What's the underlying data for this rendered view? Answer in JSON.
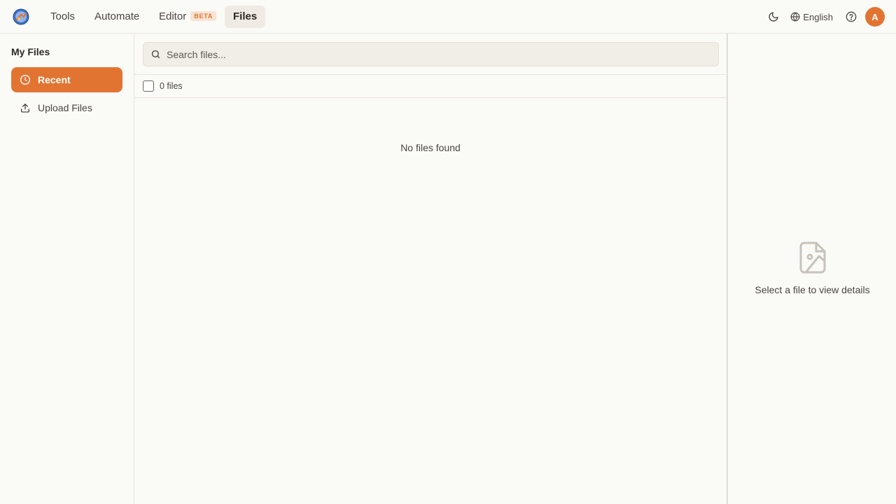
{
  "topbar": {
    "nav": [
      {
        "label": "Tools"
      },
      {
        "label": "Automate"
      },
      {
        "label": "Editor",
        "badge": "BETA"
      },
      {
        "label": "Files"
      }
    ],
    "language": "English",
    "avatar_initial": "A"
  },
  "sidebar": {
    "title": "My Files",
    "items": [
      {
        "label": "Recent",
        "icon": "clock-icon",
        "active": true
      },
      {
        "label": "Upload Files",
        "icon": "upload-icon",
        "active": false
      }
    ]
  },
  "main": {
    "search_placeholder": "Search files...",
    "file_count": "0 files",
    "empty_message": "No files found"
  },
  "details": {
    "message": "Select a file to view details"
  },
  "colors": {
    "accent": "#e27432",
    "background": "#fafaf7"
  }
}
